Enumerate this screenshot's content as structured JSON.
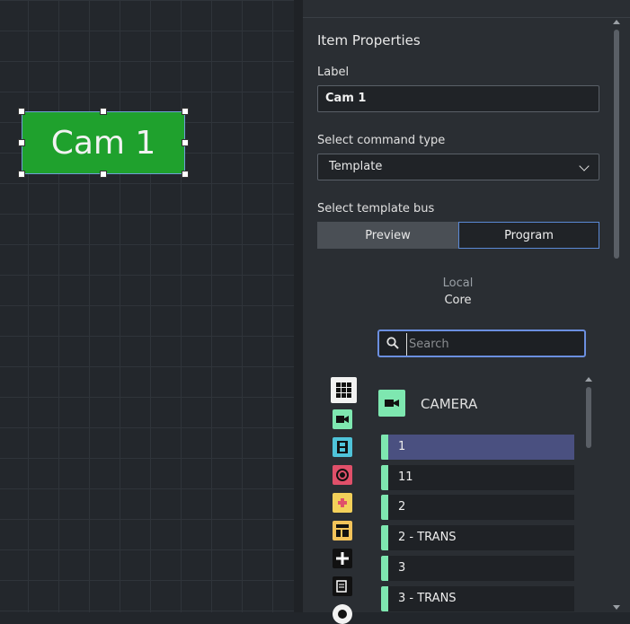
{
  "canvas": {
    "item_label": "Cam 1",
    "item_color": "#1fa12d"
  },
  "panel": {
    "title": "Item Properties",
    "label_field": {
      "label": "Label",
      "value": "Cam 1"
    },
    "command_type": {
      "label": "Select command type",
      "value": "Template"
    },
    "template_bus": {
      "label": "Select template bus",
      "options": [
        "Preview",
        "Program"
      ],
      "selected": "Program"
    },
    "source": {
      "local": "Local",
      "core": "Core"
    },
    "search": {
      "placeholder": "Search"
    },
    "categories": [
      {
        "icon": "grid-icon",
        "color": "#f2f2f2"
      },
      {
        "icon": "camera-icon",
        "color": "#7ee7b0"
      },
      {
        "icon": "film-icon",
        "color": "#4fc3d9"
      },
      {
        "icon": "record-icon",
        "color": "#e0506a"
      },
      {
        "icon": "gamepad-icon",
        "color": "#f3d05a"
      },
      {
        "icon": "layout-icon",
        "color": "#f3c35a"
      },
      {
        "icon": "plus-icon",
        "color": "#111111"
      },
      {
        "icon": "document-icon",
        "color": "#111111"
      }
    ],
    "camera_header": "CAMERA",
    "camera_items": [
      "1",
      "11",
      "2",
      "2 - TRANS",
      "3",
      "3 - TRANS"
    ],
    "selected_item": "1"
  }
}
